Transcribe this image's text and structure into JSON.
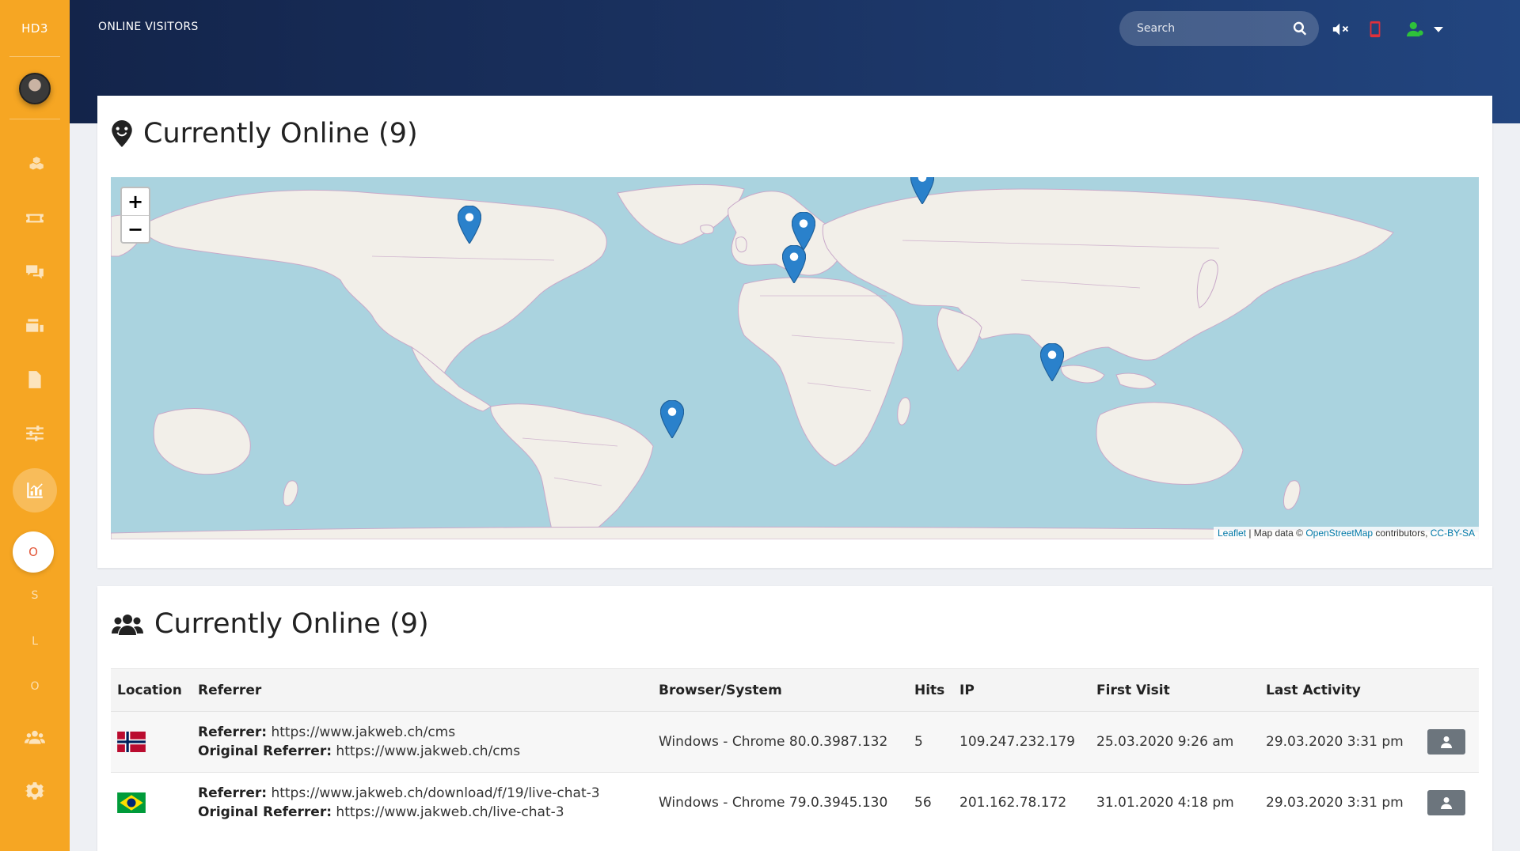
{
  "app": {
    "brand": "HD3",
    "page_label": "ONLINE VISITORS"
  },
  "search": {
    "placeholder": "Search"
  },
  "sidebar": {
    "items": [
      {
        "icon": "cubes-icon"
      },
      {
        "icon": "ticket-icon"
      },
      {
        "icon": "chat-icon"
      },
      {
        "icon": "inbox-stack-icon"
      },
      {
        "icon": "document-icon"
      },
      {
        "icon": "sliders-icon"
      },
      {
        "icon": "chart-icon",
        "active": true
      },
      {
        "icon": "users-icon"
      },
      {
        "icon": "gear-icon"
      }
    ],
    "letters": [
      "O",
      "S",
      "L",
      "O"
    ]
  },
  "header_icons": [
    "mute-icon",
    "phone-icon",
    "user-online-icon",
    "caret-down-icon",
    "power-icon"
  ],
  "colors": {
    "sidebar": "#f6a623",
    "header": "#1a3261",
    "phone": "#e0313b",
    "user_online": "#2ec23a",
    "map_water": "#aad3df",
    "map_land": "#f2efe9",
    "marker": "#2a81cb"
  },
  "map_card": {
    "title": "Currently Online (9)",
    "zoom_in": "+",
    "zoom_out": "−",
    "attribution": {
      "leaflet": "Leaflet",
      "sep": " | Map data © ",
      "osm": "OpenStreetMap",
      "mid": " contributors, ",
      "license": "CC-BY-SA"
    }
  },
  "table_card": {
    "title": "Currently Online (9)",
    "columns": [
      "Location",
      "Referrer",
      "Browser/System",
      "Hits",
      "IP",
      "First Visit",
      "Last Activity"
    ],
    "rows": [
      {
        "flag": "norway",
        "referrer_label": "Referrer:",
        "referrer": "https://www.jakweb.ch/cms",
        "orig_label": "Original Referrer:",
        "original_referrer": "https://www.jakweb.ch/cms",
        "browser": "Windows - Chrome 80.0.3987.132",
        "hits": "5",
        "ip": "109.247.232.179",
        "first_visit": "25.03.2020 9:26 am",
        "last_activity": "29.03.2020 3:31 pm"
      },
      {
        "flag": "brazil",
        "referrer_label": "Referrer:",
        "referrer": "https://www.jakweb.ch/download/f/19/live-chat-3",
        "orig_label": "Original Referrer:",
        "original_referrer": "https://www.jakweb.ch/live-chat-3",
        "browser": "Windows - Chrome 79.0.3945.130",
        "hits": "56",
        "ip": "201.162.78.172",
        "first_visit": "31.01.2020 4:18 pm",
        "last_activity": "29.03.2020 3:31 pm"
      }
    ]
  }
}
